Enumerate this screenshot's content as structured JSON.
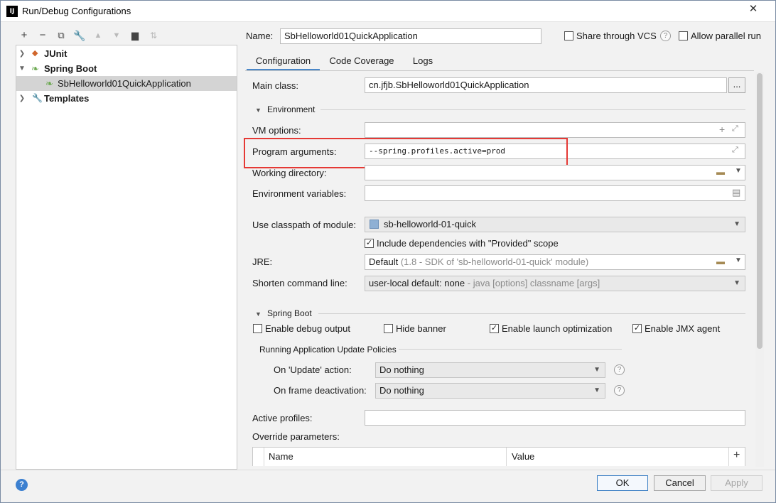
{
  "window": {
    "title": "Run/Debug Configurations",
    "app_icon": "IJ"
  },
  "tree": {
    "items": [
      {
        "label": "JUnit",
        "icon": "junit-icon"
      },
      {
        "label": "Spring Boot",
        "icon": "spring-boot-icon"
      },
      {
        "label": "SbHelloworld01QuickApplication",
        "icon": "spring-app-icon"
      },
      {
        "label": "Templates",
        "icon": "wrench-icon"
      }
    ]
  },
  "form": {
    "name_label": "Name:",
    "name_value": "SbHelloworld01QuickApplication",
    "share_label": "Share through VCS",
    "parallel_label": "Allow parallel run",
    "tabs": [
      "Configuration",
      "Code Coverage",
      "Logs"
    ],
    "main_class_label": "Main class:",
    "main_class_value": "cn.jfjb.SbHelloworld01QuickApplication",
    "browse_label": "...",
    "environment_label": "Environment",
    "vm_options_label": "VM options:",
    "program_args_label": "Program arguments:",
    "program_args_value": "--spring.profiles.active=prod",
    "working_dir_label": "Working directory:",
    "env_vars_label": "Environment variables:",
    "classpath_label": "Use classpath of module:",
    "classpath_value": "sb-helloworld-01-quick",
    "include_deps_label": "Include dependencies with \"Provided\" scope",
    "jre_label": "JRE:",
    "jre_value": "Default",
    "jre_hint": "(1.8 - SDK of 'sb-helloworld-01-quick' module)",
    "shorten_label": "Shorten command line:",
    "shorten_value": "user-local default: none",
    "shorten_hint": " - java [options] classname [args]",
    "spring_boot_label": "Spring Boot",
    "debug_output_label": "Enable debug output",
    "hide_banner_label": "Hide banner",
    "launch_opt_label": "Enable launch optimization",
    "jmx_label": "Enable JMX agent",
    "update_policies_label": "Running Application Update Policies",
    "update_action_label": "On 'Update' action:",
    "update_action_value": "Do nothing",
    "frame_deact_label": "On frame deactivation:",
    "frame_deact_value": "Do nothing",
    "active_profiles_label": "Active profiles:",
    "override_label": "Override parameters:",
    "table_headers": [
      "Name",
      "Value"
    ]
  },
  "buttons": {
    "ok": "OK",
    "cancel": "Cancel",
    "apply": "Apply"
  },
  "colors": {
    "highlight": "#e53935",
    "accent": "#4a87c8"
  }
}
